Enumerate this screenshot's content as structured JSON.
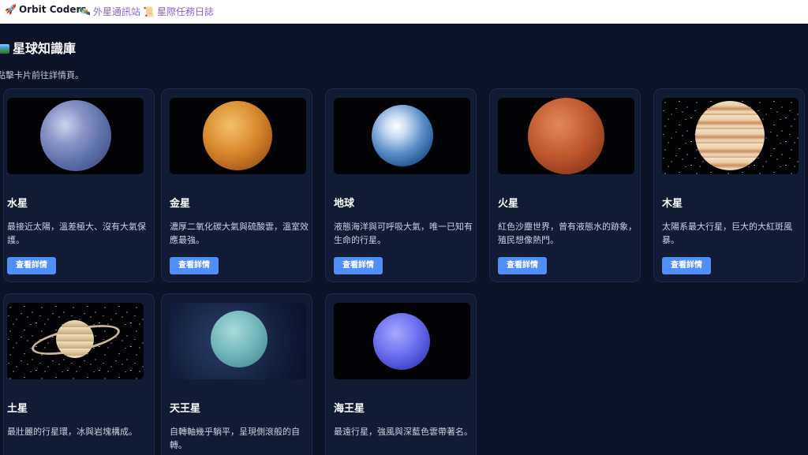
{
  "nav": {
    "brand": "Orbit Coders",
    "brand_icon": "rocket-icon",
    "links": [
      {
        "label": "外星通訊站",
        "icon": "satellite-icon"
      },
      {
        "label": "星際任務日誌",
        "icon": "scroll-icon"
      }
    ]
  },
  "page": {
    "title": "星球知識庫",
    "title_icon": "world-map-icon",
    "hint": "點擊卡片前往詳情頁。"
  },
  "cards": [
    {
      "name": "水星",
      "desc": "最接近太陽，溫差極大、沒有大氣保護。",
      "button": "查看詳情"
    },
    {
      "name": "金星",
      "desc": "濃厚二氧化碳大氣與硫酸雲，溫室效應最強。",
      "button": "查看詳情"
    },
    {
      "name": "地球",
      "desc": "液態海洋與可呼吸大氣，唯一已知有生命的行星。",
      "button": "查看詳情"
    },
    {
      "name": "火星",
      "desc": "紅色沙塵世界，曾有液態水的跡象，殖民想像熱門。",
      "button": "查看詳情"
    },
    {
      "name": "木星",
      "desc": "太陽系最大行星，巨大的大紅斑風暴。",
      "button": "查看詳情"
    },
    {
      "name": "土星",
      "desc": "最壯麗的行星環，冰與岩塊構成。",
      "button": "查看詳情"
    },
    {
      "name": "天王星",
      "desc": "自轉軸幾乎躺平，呈現側滾般的自轉。",
      "button": "查看詳情"
    },
    {
      "name": "海王星",
      "desc": "最遠行星，強風與深藍色雲帶著名。",
      "button": "查看詳情"
    }
  ],
  "colors": {
    "background": "#0c1327",
    "card": "#121b34",
    "accent_button": "#4f8ff7",
    "nav_link": "#8a63d2"
  }
}
